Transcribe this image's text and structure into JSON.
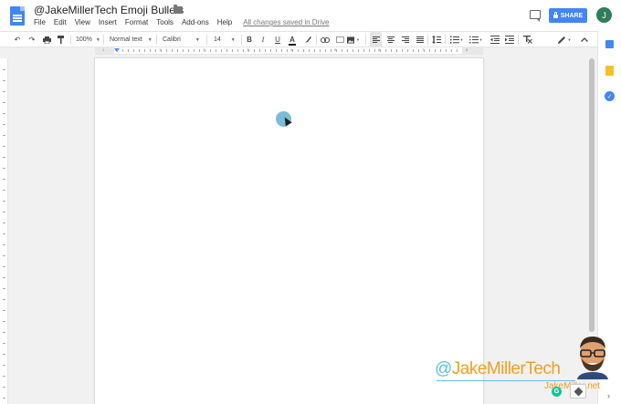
{
  "document": {
    "title": "@JakeMillerTech Emoji Bullets",
    "save_status": "All changes saved in Drive"
  },
  "menu": [
    "File",
    "Edit",
    "View",
    "Insert",
    "Format",
    "Tools",
    "Add-ons",
    "Help"
  ],
  "header": {
    "share_label": "SHARE",
    "avatar_initial": "J"
  },
  "toolbar": {
    "zoom": "100%",
    "style": "Normal text",
    "font": "Calibri",
    "size": "14",
    "bold": "B",
    "italic": "I",
    "underline": "U",
    "text_color": "A"
  },
  "ruler": {
    "h_numbers": [
      "1",
      "1",
      "2",
      "3",
      "4",
      "5",
      "6",
      "7",
      "8"
    ]
  },
  "watermark": {
    "at": "@",
    "brand": "JakeMillerTech",
    "site": "JakeMiller.net"
  },
  "colors": {
    "accent": "#4285f4",
    "avatar": "#2e7d5b",
    "watermark_orange": "#f0a020",
    "watermark_blue": "#5bc0de"
  }
}
